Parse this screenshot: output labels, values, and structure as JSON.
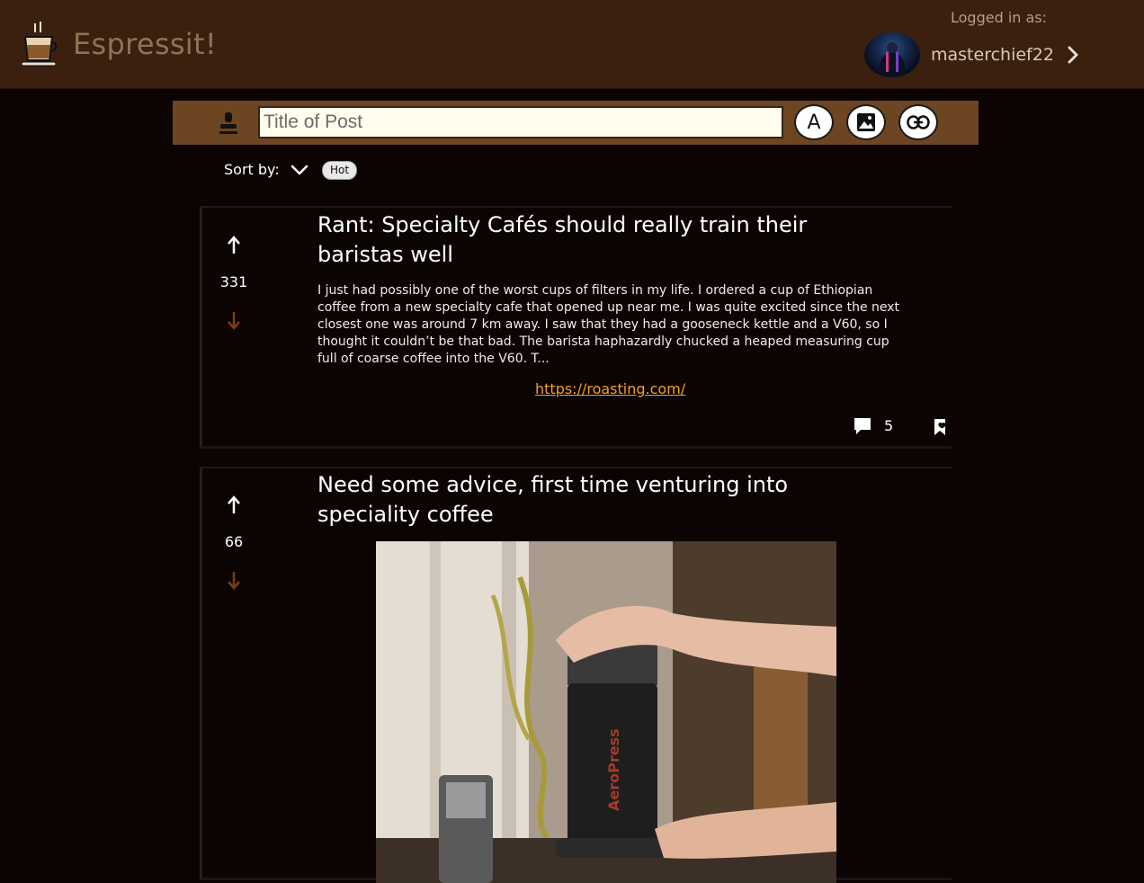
{
  "header": {
    "app_title": "Espressit!",
    "logged_in_label": "Logged in as:",
    "username": "masterchief22"
  },
  "compose": {
    "title_placeholder": "Title of Post",
    "text_button_label": "A"
  },
  "sort": {
    "label": "Sort by:",
    "selected": "Hot"
  },
  "posts": [
    {
      "score": "331",
      "title": "Rant: Specialty Cafés should really train their baristas well",
      "body": "I just had possibly one of the worst cups of filters in my life. I ordered a cup of Ethiopian coffee from a new specialty cafe that opened up near me. I was quite excited since the next closest one was around 7 km away. I saw that they had a gooseneck kettle and a V60, so I thought it couldn’t be that bad. The barista haphazardly chucked a heaped measuring cup full of coarse coffee into the V60. T...",
      "link": "https://roasting.com/",
      "comment_count": "5"
    },
    {
      "score": "66",
      "title": "Need some advice, first time venturing into speciality coffee",
      "image_text": "AeroPress"
    }
  ],
  "colors": {
    "header_bg": "#3b200f",
    "compose_bg": "#6e4522",
    "page_bg": "#0b0403",
    "link": "#f0a028",
    "downvote": "#7a3d16"
  },
  "icons": [
    "coffee-cup-icon",
    "chevron-right-icon",
    "person-icon",
    "image-icon",
    "link-icon",
    "chevron-down-icon",
    "upvote-arrow-icon",
    "downvote-arrow-icon",
    "comment-icon",
    "bookmark-icon"
  ]
}
